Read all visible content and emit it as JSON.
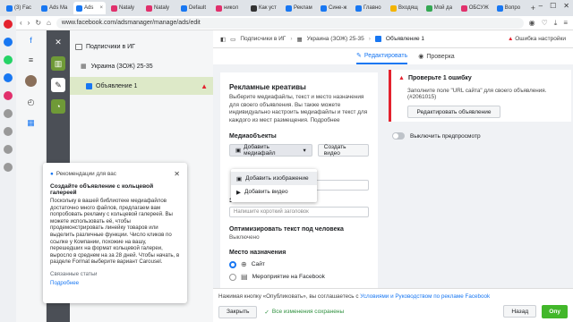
{
  "browser": {
    "tabs": [
      {
        "title": "(3) Fac",
        "color": "#1877f2"
      },
      {
        "title": "Ads Ma",
        "color": "#1877f2"
      },
      {
        "title": "Ads",
        "color": "#1877f2",
        "active": true
      },
      {
        "title": "Nataly",
        "color": "#e1306c"
      },
      {
        "title": "Nataly",
        "color": "#e1306c"
      },
      {
        "title": "Default",
        "color": "#1877f2"
      },
      {
        "title": "никол",
        "color": "#e1306c"
      },
      {
        "title": "Как уст",
        "color": "#333333"
      },
      {
        "title": "Реклам",
        "color": "#1877f2"
      },
      {
        "title": "Сине-ж",
        "color": "#1877f2"
      },
      {
        "title": "Главно",
        "color": "#1877f2"
      },
      {
        "title": "Входящ",
        "color": "#f4b400"
      },
      {
        "title": "Мой да",
        "color": "#34a853"
      },
      {
        "title": "ОБСУЖ",
        "color": "#e1306c"
      },
      {
        "title": "Вопро",
        "color": "#1877f2"
      }
    ],
    "url": "www.facebook.com/adsmanager/manage/ads/edit"
  },
  "tree": {
    "campaign": "Подписчики в ИГ",
    "adset": "Украина (ЗОЖ) 25-35",
    "ad": "Объявление 1"
  },
  "breadcrumbs": {
    "campaign": "Подписчики в ИГ",
    "adset": "Украина (ЗОЖ) 25-35",
    "ad": "Объявление 1",
    "error": "Ошибка настройки"
  },
  "tabs": {
    "edit": "Редактировать",
    "review": "Проверка"
  },
  "creative": {
    "title": "Рекламные креативы",
    "description": "Выберите медиафайлы, текст и место назначения для своего объявления. Вы также можете индивидуально настроить медиафайлы и текст для каждого из мест размещения. Подробнее",
    "media_label": "Медиаобъекты",
    "add_media": "Добавить медиафайл",
    "create_video": "Создать видео",
    "menu_add_image": "Добавить изображение",
    "menu_add_video": "Добавить видео",
    "headline_label": "Заголовок",
    "headline_optional": "· Необязательно",
    "headline_placeholder": "Напишите короткий заголовок",
    "optimize_label": "Оптимизировать текст под человека",
    "optimize_value": "Выключено",
    "destination_label": "Место назначения",
    "destination_site": "Сайт",
    "destination_event": "Мероприятие на Facebook"
  },
  "errors": {
    "title": "Проверьте 1 ошибку",
    "message": "Заполните поле \"URL сайта\" для своего объявления. (#2061015)",
    "button": "Редактировать объявление"
  },
  "preview_toggle": "Выключить предпросмотр",
  "tip": {
    "header": "Рекомендации для вас",
    "title": "Создайте объявление с кольцевой галереей",
    "body": "Поскольку в вашей библиотеке медиафайлов достаточно много файлов, предлагаем вам попробовать рекламу с кольцевой галереей. Вы можете использовать её, чтобы продемонстрировать линейку товаров или выделить различные функции. Число кликов по ссылке у Компании, похожие на вашу, перешедших на формат кольцевой галереи, выросло в среднем на за 28 дней. Чтобы начать, в разделе Format выберите вариант Carousel.",
    "related": "Связанные статьи",
    "more": "Подробнее"
  },
  "footer": {
    "agree_prefix": "Нажимая кнопку «Опубликовать», вы соглашаетесь с",
    "agree_link": "Условиями и Руководством по рекламе Facebook",
    "close": "Закрыть",
    "saved": "Все изменения сохранены",
    "back": "Назад",
    "publish": "Опу"
  }
}
